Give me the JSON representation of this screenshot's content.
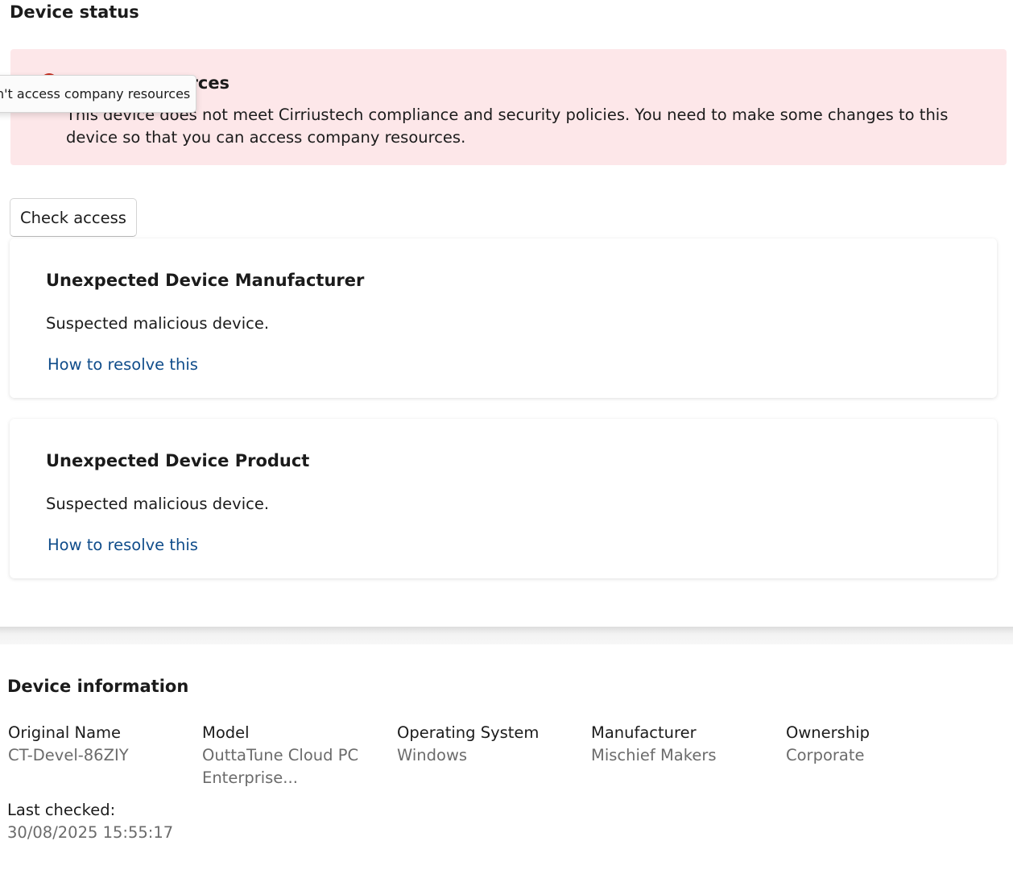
{
  "device_status": {
    "title": "Device status",
    "alert": {
      "title": "mpany resources",
      "message": "This device does not meet Cirriustech compliance and security policies. You need to make some changes to this device so that you can access company resources.",
      "tooltip": "n't access company resources",
      "status_color": "#c42b1c",
      "icon": "error-icon"
    },
    "check_access_label": "Check access",
    "issues": [
      {
        "title": "Unexpected Device Manufacturer",
        "description": "Suspected malicious device.",
        "link": "How to resolve this"
      },
      {
        "title": "Unexpected Device Product",
        "description": "Suspected malicious device.",
        "link": "How to resolve this"
      }
    ]
  },
  "device_info": {
    "title": "Device information",
    "fields": [
      {
        "label": "Original Name",
        "value": "CT-Devel-86ZIY"
      },
      {
        "label": "Model",
        "value": "OuttaTune Cloud PC Enterprise..."
      },
      {
        "label": "Operating System",
        "value": "Windows"
      },
      {
        "label": "Manufacturer",
        "value": "Mischief Makers"
      },
      {
        "label": "Ownership",
        "value": "Corporate"
      }
    ],
    "last_checked": {
      "label": "Last checked:",
      "value": "30/08/2025 15:55:17"
    }
  },
  "colors": {
    "alert_background": "#fde7e9",
    "link": "#0f4c8a",
    "muted_text": "#6b6b6b"
  }
}
